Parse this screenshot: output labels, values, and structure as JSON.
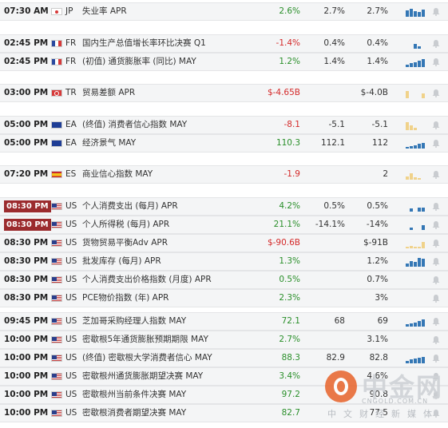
{
  "colors": {
    "positive": "#2a8f2a",
    "negative": "#d42a2a",
    "highlight_time": "#9b2b2e",
    "bar_dark": "#3477b5",
    "bar_light": "#f0d28a"
  },
  "rows": [
    {
      "time": "07:30 AM",
      "hl": false,
      "cc": "JP",
      "event": "失业率 APR",
      "actual": "2.6%",
      "act_color": "g",
      "forecast": "2.7%",
      "previous": "2.7%",
      "spark": [
        8,
        10,
        7,
        6,
        9
      ],
      "spark_color": "blue",
      "group": 0
    },
    {
      "time": "02:45 PM",
      "hl": false,
      "cc": "FR",
      "event": "国内生产总值增长率环比决赛 Q1",
      "actual": "-1.4%",
      "act_color": "r",
      "forecast": "0.4%",
      "previous": "0.4%",
      "spark": [
        0,
        0,
        6,
        3,
        0
      ],
      "spark_color": "blue",
      "group": 1
    },
    {
      "time": "02:45 PM",
      "hl": false,
      "cc": "FR",
      "event": "(初值) 通货膨胀率 (同比) MAY",
      "actual": "1.2%",
      "act_color": "g",
      "forecast": "1.4%",
      "previous": "1.4%",
      "spark": [
        3,
        5,
        6,
        8,
        10
      ],
      "spark_color": "blue",
      "group": 1
    },
    {
      "time": "03:00 PM",
      "hl": false,
      "cc": "TR",
      "event": "贸易差额 APR",
      "actual": "$-4.65B",
      "act_color": "r",
      "forecast": "",
      "previous": "$-4.0B",
      "spark": [
        9,
        0,
        0,
        0,
        6
      ],
      "spark_color": "light",
      "group": 2
    },
    {
      "time": "05:00 PM",
      "hl": false,
      "cc": "EA",
      "event": "(终值) 消费者信心指数 MAY",
      "actual": "-8.1",
      "act_color": "r",
      "forecast": "-5.1",
      "previous": "-5.1",
      "spark": [
        10,
        6,
        3,
        0,
        0
      ],
      "spark_color": "light",
      "group": 3
    },
    {
      "time": "05:00 PM",
      "hl": false,
      "cc": "EA",
      "event": "经济景气 MAY",
      "actual": "110.3",
      "act_color": "g",
      "forecast": "112.1",
      "previous": "112",
      "spark": [
        2,
        3,
        4,
        6,
        7
      ],
      "spark_color": "blue",
      "group": 3
    },
    {
      "time": "07:20 PM",
      "hl": false,
      "cc": "ES",
      "event": "商业信心指数 MAY",
      "actual": "-1.9",
      "act_color": "r",
      "forecast": "",
      "previous": "2",
      "spark": [
        4,
        8,
        3,
        2,
        0
      ],
      "spark_color": "light",
      "group": 4
    },
    {
      "time": "08:30 PM",
      "hl": true,
      "cc": "US",
      "event": "个人消费支出 (每月) APR",
      "actual": "4.2%",
      "act_color": "g",
      "forecast": "0.5%",
      "previous": "0.5%",
      "spark": [
        0,
        4,
        0,
        5,
        5
      ],
      "spark_color": "blue",
      "group": 5
    },
    {
      "time": "08:30 PM",
      "hl": true,
      "cc": "US",
      "event": "个人所得税 (每月) APR",
      "actual": "21.1%",
      "act_color": "g",
      "forecast": "-14.1%",
      "previous": "-14%",
      "spark": [
        0,
        3,
        0,
        0,
        6
      ],
      "spark_color": "blue",
      "group": 5
    },
    {
      "time": "08:30 PM",
      "hl": false,
      "cc": "US",
      "event": "货物贸易平衡Adv APR",
      "actual": "$-90.6B",
      "act_color": "r",
      "forecast": "",
      "previous": "$-91B",
      "spark": [
        2,
        3,
        2,
        2,
        8
      ],
      "spark_color": "light",
      "group": 5
    },
    {
      "time": "08:30 PM",
      "hl": false,
      "cc": "US",
      "event": "批发库存 (每月) APR",
      "actual": "1.3%",
      "act_color": "g",
      "forecast": "",
      "previous": "1.2%",
      "spark": [
        4,
        7,
        6,
        11,
        10
      ],
      "spark_color": "blue",
      "group": 5
    },
    {
      "time": "08:30 PM",
      "hl": false,
      "cc": "US",
      "event": "个人消费支出价格指数 (月度) APR",
      "actual": "0.5%",
      "act_color": "g",
      "forecast": "",
      "previous": "0.7%",
      "spark": [
        0,
        0,
        0,
        0,
        0
      ],
      "spark_color": "blue",
      "group": 5
    },
    {
      "time": "08:30 PM",
      "hl": false,
      "cc": "US",
      "event": "PCE物价指数 (年) APR",
      "actual": "2.3%",
      "act_color": "g",
      "forecast": "",
      "previous": "3%",
      "spark": [
        0,
        0,
        0,
        0,
        0
      ],
      "spark_color": "blue",
      "group": 5
    },
    {
      "time": "09:45 PM",
      "hl": false,
      "cc": "US",
      "event": "芝加哥采购经理人指数 MAY",
      "actual": "72.1",
      "act_color": "g",
      "forecast": "68",
      "previous": "69",
      "spark": [
        3,
        4,
        5,
        7,
        9
      ],
      "spark_color": "blue",
      "group": 6
    },
    {
      "time": "10:00 PM",
      "hl": false,
      "cc": "US",
      "event": "密歇根5年通货膨胀预期期限 MAY",
      "actual": "2.7%",
      "act_color": "g",
      "forecast": "",
      "previous": "3.1%",
      "spark": [
        0,
        0,
        0,
        0,
        0
      ],
      "spark_color": "blue",
      "group": 6
    },
    {
      "time": "10:00 PM",
      "hl": false,
      "cc": "US",
      "event": "(终值) 密歇根大学消费者信心 MAY",
      "actual": "88.3",
      "act_color": "g",
      "forecast": "82.9",
      "previous": "82.8",
      "spark": [
        3,
        5,
        6,
        7,
        8
      ],
      "spark_color": "blue",
      "group": 6
    },
    {
      "time": "10:00 PM",
      "hl": false,
      "cc": "US",
      "event": "密歇根州通货膨胀期望决赛 MAY",
      "actual": "3.4%",
      "act_color": "g",
      "forecast": "",
      "previous": "4.6%",
      "spark": [
        0,
        0,
        0,
        0,
        0
      ],
      "spark_color": "blue",
      "group": 6
    },
    {
      "time": "10:00 PM",
      "hl": false,
      "cc": "US",
      "event": "密歇根州当前条件决赛 MAY",
      "actual": "97.2",
      "act_color": "g",
      "forecast": "",
      "previous": "90.8",
      "spark": [
        0,
        0,
        0,
        0,
        0
      ],
      "spark_color": "blue",
      "group": 6
    },
    {
      "time": "10:00 PM",
      "hl": false,
      "cc": "US",
      "event": "密歇根消费者期望决赛 MAY",
      "actual": "82.7",
      "act_color": "g",
      "forecast": "",
      "previous": "77.5",
      "spark": [
        0,
        0,
        0,
        0,
        0
      ],
      "spark_color": "blue",
      "group": 6
    }
  ],
  "watermark": {
    "brand_cn": "中金网",
    "url": "CNGOLD.COM.CN",
    "tagline": "中文财经新媒体"
  }
}
